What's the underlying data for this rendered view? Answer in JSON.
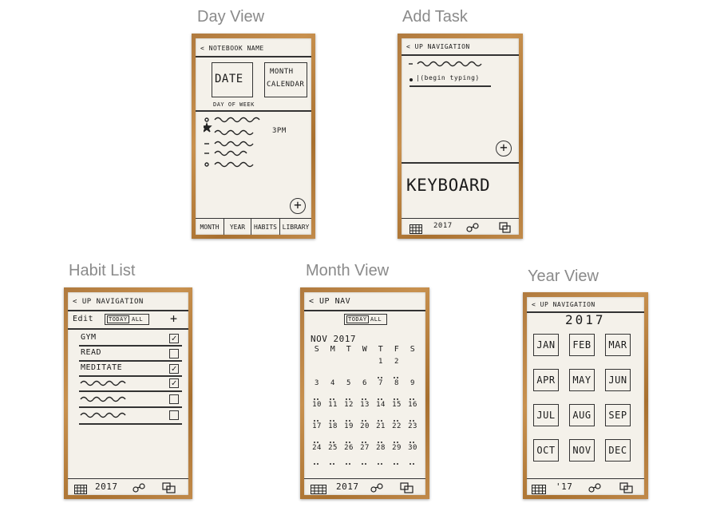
{
  "titles": {
    "day_view": "Day View",
    "add_task": "Add Task",
    "habit_list": "Habit List",
    "month_view": "Month View",
    "year_view": "Year View"
  },
  "day_view": {
    "header": "< NOTEBOOK NAME",
    "date_box": "DATE",
    "day_of_week": "DAY OF WEEK",
    "month_calendar_1": "MONTH",
    "month_calendar_2": "CALENDAR",
    "task_time": "3PM",
    "plus": "+",
    "tabs": [
      "MONTH",
      "YEAR",
      "HABITS",
      "LIBRARY"
    ]
  },
  "add_task": {
    "header": "< UP NAVIGATION",
    "typing": "|(begin typing)",
    "plus": "+",
    "keyboard": "KEYBOARD",
    "footer_year": "2017"
  },
  "habit_list": {
    "header": "< UP NAVIGATION",
    "edit": "Edit",
    "filter_today": "TODAY",
    "filter_all": "ALL",
    "plus": "+",
    "habits": [
      "GYM",
      "READ",
      "MEDITATE"
    ],
    "check_mark": "✓",
    "footer_year": "2017"
  },
  "month_view": {
    "header": "< UP NAV",
    "filter_today": "TODAY",
    "filter_all": "ALL",
    "month_label": "NOV 2017",
    "weekdays": [
      "S",
      "M",
      "T",
      "W",
      "T",
      "F",
      "S"
    ],
    "weeks": [
      [
        "",
        "",
        "",
        "",
        "1",
        "2",
        ""
      ],
      [
        "3",
        "4",
        "5",
        "6",
        "7",
        "8",
        "9"
      ],
      [
        "10",
        "11",
        "12",
        "13",
        "14",
        "15",
        "16"
      ],
      [
        "17",
        "18",
        "19",
        "20",
        "21",
        "22",
        "23"
      ],
      [
        "24",
        "25",
        "26",
        "27",
        "28",
        "29",
        "30"
      ]
    ],
    "footer_year": "2017"
  },
  "year_view": {
    "header": "< UP NAVIGATION",
    "year": "2017",
    "months": [
      "JAN",
      "FEB",
      "MAR",
      "APR",
      "MAY",
      "JUN",
      "JUL",
      "AUG",
      "SEP",
      "OCT",
      "NOV",
      "DEC"
    ],
    "footer_year": "'17"
  }
}
